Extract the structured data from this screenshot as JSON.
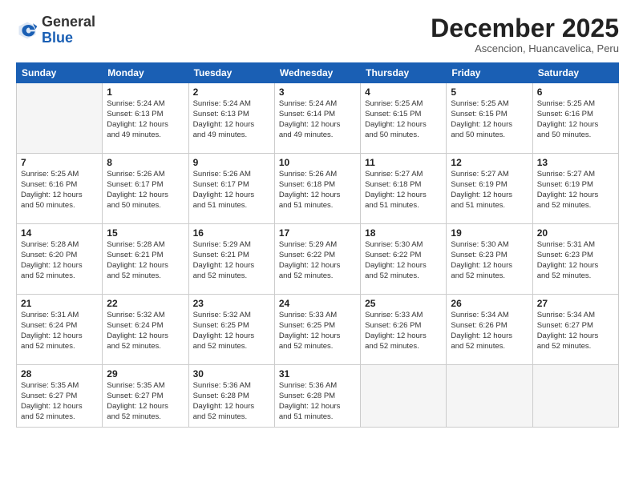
{
  "logo": {
    "general": "General",
    "blue": "Blue"
  },
  "header": {
    "month": "December 2025",
    "location": "Ascencion, Huancavelica, Peru"
  },
  "weekdays": [
    "Sunday",
    "Monday",
    "Tuesday",
    "Wednesday",
    "Thursday",
    "Friday",
    "Saturday"
  ],
  "weeks": [
    [
      {
        "day": "",
        "info": ""
      },
      {
        "day": "1",
        "info": "Sunrise: 5:24 AM\nSunset: 6:13 PM\nDaylight: 12 hours\nand 49 minutes."
      },
      {
        "day": "2",
        "info": "Sunrise: 5:24 AM\nSunset: 6:13 PM\nDaylight: 12 hours\nand 49 minutes."
      },
      {
        "day": "3",
        "info": "Sunrise: 5:24 AM\nSunset: 6:14 PM\nDaylight: 12 hours\nand 49 minutes."
      },
      {
        "day": "4",
        "info": "Sunrise: 5:25 AM\nSunset: 6:15 PM\nDaylight: 12 hours\nand 50 minutes."
      },
      {
        "day": "5",
        "info": "Sunrise: 5:25 AM\nSunset: 6:15 PM\nDaylight: 12 hours\nand 50 minutes."
      },
      {
        "day": "6",
        "info": "Sunrise: 5:25 AM\nSunset: 6:16 PM\nDaylight: 12 hours\nand 50 minutes."
      }
    ],
    [
      {
        "day": "7",
        "info": "Sunrise: 5:25 AM\nSunset: 6:16 PM\nDaylight: 12 hours\nand 50 minutes."
      },
      {
        "day": "8",
        "info": "Sunrise: 5:26 AM\nSunset: 6:17 PM\nDaylight: 12 hours\nand 50 minutes."
      },
      {
        "day": "9",
        "info": "Sunrise: 5:26 AM\nSunset: 6:17 PM\nDaylight: 12 hours\nand 51 minutes."
      },
      {
        "day": "10",
        "info": "Sunrise: 5:26 AM\nSunset: 6:18 PM\nDaylight: 12 hours\nand 51 minutes."
      },
      {
        "day": "11",
        "info": "Sunrise: 5:27 AM\nSunset: 6:18 PM\nDaylight: 12 hours\nand 51 minutes."
      },
      {
        "day": "12",
        "info": "Sunrise: 5:27 AM\nSunset: 6:19 PM\nDaylight: 12 hours\nand 51 minutes."
      },
      {
        "day": "13",
        "info": "Sunrise: 5:27 AM\nSunset: 6:19 PM\nDaylight: 12 hours\nand 52 minutes."
      }
    ],
    [
      {
        "day": "14",
        "info": "Sunrise: 5:28 AM\nSunset: 6:20 PM\nDaylight: 12 hours\nand 52 minutes."
      },
      {
        "day": "15",
        "info": "Sunrise: 5:28 AM\nSunset: 6:21 PM\nDaylight: 12 hours\nand 52 minutes."
      },
      {
        "day": "16",
        "info": "Sunrise: 5:29 AM\nSunset: 6:21 PM\nDaylight: 12 hours\nand 52 minutes."
      },
      {
        "day": "17",
        "info": "Sunrise: 5:29 AM\nSunset: 6:22 PM\nDaylight: 12 hours\nand 52 minutes."
      },
      {
        "day": "18",
        "info": "Sunrise: 5:30 AM\nSunset: 6:22 PM\nDaylight: 12 hours\nand 52 minutes."
      },
      {
        "day": "19",
        "info": "Sunrise: 5:30 AM\nSunset: 6:23 PM\nDaylight: 12 hours\nand 52 minutes."
      },
      {
        "day": "20",
        "info": "Sunrise: 5:31 AM\nSunset: 6:23 PM\nDaylight: 12 hours\nand 52 minutes."
      }
    ],
    [
      {
        "day": "21",
        "info": "Sunrise: 5:31 AM\nSunset: 6:24 PM\nDaylight: 12 hours\nand 52 minutes."
      },
      {
        "day": "22",
        "info": "Sunrise: 5:32 AM\nSunset: 6:24 PM\nDaylight: 12 hours\nand 52 minutes."
      },
      {
        "day": "23",
        "info": "Sunrise: 5:32 AM\nSunset: 6:25 PM\nDaylight: 12 hours\nand 52 minutes."
      },
      {
        "day": "24",
        "info": "Sunrise: 5:33 AM\nSunset: 6:25 PM\nDaylight: 12 hours\nand 52 minutes."
      },
      {
        "day": "25",
        "info": "Sunrise: 5:33 AM\nSunset: 6:26 PM\nDaylight: 12 hours\nand 52 minutes."
      },
      {
        "day": "26",
        "info": "Sunrise: 5:34 AM\nSunset: 6:26 PM\nDaylight: 12 hours\nand 52 minutes."
      },
      {
        "day": "27",
        "info": "Sunrise: 5:34 AM\nSunset: 6:27 PM\nDaylight: 12 hours\nand 52 minutes."
      }
    ],
    [
      {
        "day": "28",
        "info": "Sunrise: 5:35 AM\nSunset: 6:27 PM\nDaylight: 12 hours\nand 52 minutes."
      },
      {
        "day": "29",
        "info": "Sunrise: 5:35 AM\nSunset: 6:27 PM\nDaylight: 12 hours\nand 52 minutes."
      },
      {
        "day": "30",
        "info": "Sunrise: 5:36 AM\nSunset: 6:28 PM\nDaylight: 12 hours\nand 52 minutes."
      },
      {
        "day": "31",
        "info": "Sunrise: 5:36 AM\nSunset: 6:28 PM\nDaylight: 12 hours\nand 51 minutes."
      },
      {
        "day": "",
        "info": ""
      },
      {
        "day": "",
        "info": ""
      },
      {
        "day": "",
        "info": ""
      }
    ]
  ]
}
